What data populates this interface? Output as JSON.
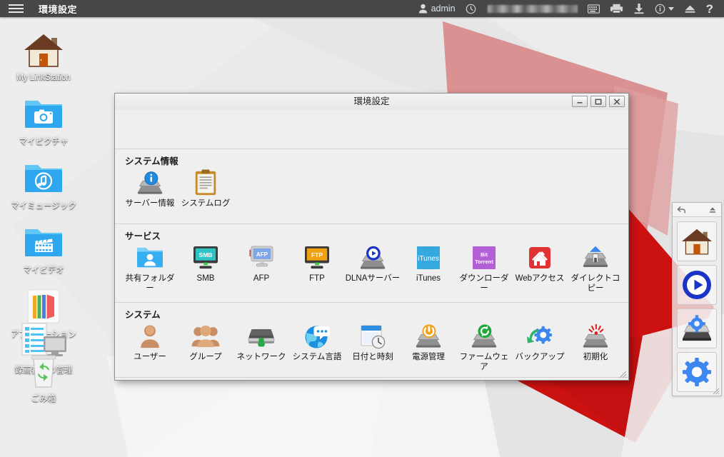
{
  "topbar": {
    "menu_icon": "hamburger-menu-icon",
    "app_title": "環境設定",
    "user_icon": "user-icon",
    "user_name": "admin",
    "clock_icon": "clock-icon",
    "masked_text": "",
    "right_icons": [
      {
        "name": "keyboard-icon",
        "label": "keyboard"
      },
      {
        "name": "printer-icon",
        "label": "printer"
      },
      {
        "name": "download-icon",
        "label": "download"
      },
      {
        "name": "info-icon",
        "label": "info"
      },
      {
        "name": "eject-icon",
        "label": "eject"
      },
      {
        "name": "help-icon",
        "label": "?"
      }
    ],
    "help_label": "?"
  },
  "desktop_icons": [
    {
      "label": "My LinkStation",
      "icon": "house-icon"
    },
    {
      "label": "マイピクチャ",
      "icon": "picture-folder-icon"
    },
    {
      "label": "マイミュージック",
      "icon": "music-folder-icon"
    },
    {
      "label": "マイビデオ",
      "icon": "video-folder-icon"
    },
    {
      "label": "アプリケーション",
      "icon": "applications-icon"
    },
    {
      "label": "録画番組の管理",
      "icon": "recorded-programs-icon"
    },
    {
      "label": "ごみ箱",
      "icon": "trash-icon"
    }
  ],
  "dock": {
    "back_icon": "back-arrow-icon",
    "collapse_icon": "collapse-arrow-icon",
    "buttons": [
      {
        "name": "dock-home-button",
        "icon": "house-icon"
      },
      {
        "name": "dock-media-button",
        "icon": "play-circle-icon"
      },
      {
        "name": "dock-nas-settings-button",
        "icon": "nas-gear-icon"
      },
      {
        "name": "dock-settings-button",
        "icon": "gear-icon"
      }
    ]
  },
  "dialog": {
    "title": "環境設定",
    "window_buttons": {
      "minimize": "minimize-icon",
      "maximize": "maximize-icon",
      "close": "close-icon"
    },
    "sections": [
      {
        "title": "システム情報",
        "items": [
          {
            "label": "サーバー情報",
            "icon": "server-info-icon"
          },
          {
            "label": "システムログ",
            "icon": "system-log-icon"
          }
        ]
      },
      {
        "title": "サービス",
        "items": [
          {
            "label": "共有フォルダー",
            "icon": "shared-folder-icon"
          },
          {
            "label": "SMB",
            "icon": "smb-monitor-icon"
          },
          {
            "label": "AFP",
            "icon": "afp-monitor-icon"
          },
          {
            "label": "FTP",
            "icon": "ftp-monitor-icon"
          },
          {
            "label": "DLNAサーバー",
            "icon": "dlna-server-icon"
          },
          {
            "label": "iTunes",
            "icon": "itunes-icon"
          },
          {
            "label": "ダウンローダー",
            "icon": "bittorrent-icon"
          },
          {
            "label": "Webアクセス",
            "icon": "web-access-icon"
          },
          {
            "label": "ダイレクトコピー",
            "icon": "direct-copy-icon"
          }
        ]
      },
      {
        "title": "システム",
        "items": [
          {
            "label": "ユーザー",
            "icon": "user-icon"
          },
          {
            "label": "グループ",
            "icon": "group-icon"
          },
          {
            "label": "ネットワーク",
            "icon": "network-icon"
          },
          {
            "label": "システム言語",
            "icon": "system-language-icon"
          },
          {
            "label": "日付と時刻",
            "icon": "date-time-icon"
          },
          {
            "label": "電源管理",
            "icon": "power-management-icon"
          },
          {
            "label": "ファームウェア",
            "icon": "firmware-icon"
          },
          {
            "label": "バックアップ",
            "icon": "backup-icon"
          },
          {
            "label": "初期化",
            "icon": "format-initialize-icon"
          }
        ]
      }
    ]
  },
  "colors": {
    "topbar_bg": "#474747",
    "desktop_bg": "#eaeaea",
    "accent_red": "#cc1111",
    "accent_red_soft": "#d48a8a",
    "dialog_bg": "#efefef",
    "folder_blue": "#2ea7ef"
  }
}
